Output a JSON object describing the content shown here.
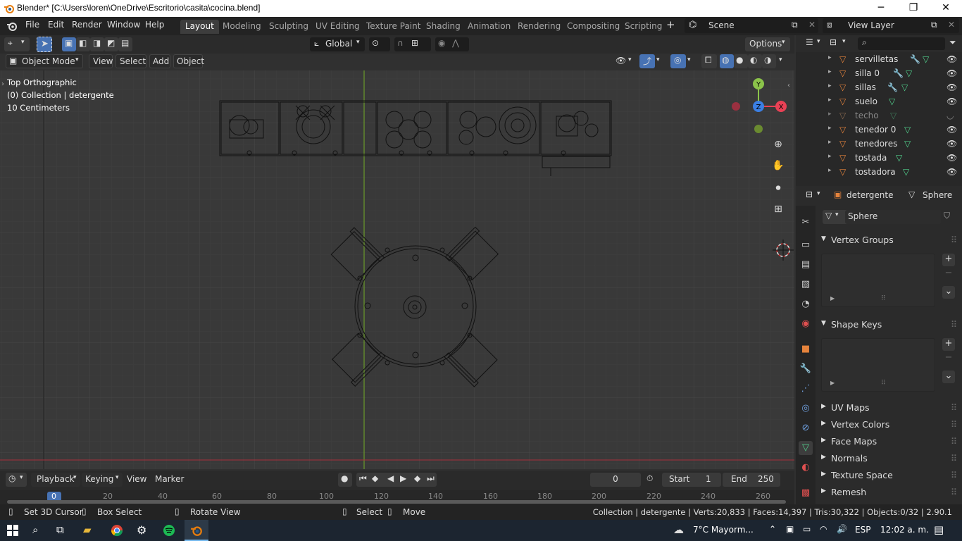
{
  "window": {
    "title": "Blender* [C:\\Users\\loren\\OneDrive\\Escritorio\\casita\\cocina.blend]",
    "minimize": "─",
    "maximize": "❐",
    "close": "✕"
  },
  "menu": {
    "items": [
      "File",
      "Edit",
      "Render",
      "Window",
      "Help"
    ]
  },
  "workspaces": {
    "tabs": [
      "Layout",
      "Modeling",
      "Sculpting",
      "UV Editing",
      "Texture Paint",
      "Shading",
      "Animation",
      "Rendering",
      "Compositing",
      "Scripting"
    ],
    "active": "Layout",
    "add": "+"
  },
  "scene": {
    "name": "Scene",
    "view_layer": "View Layer"
  },
  "toolbar": {
    "orientation": "Global",
    "options": "Options"
  },
  "viewport_header": {
    "mode": "Object Mode",
    "menus": [
      "View",
      "Select",
      "Add",
      "Object"
    ]
  },
  "viewport": {
    "view_name": "Top Orthographic",
    "collection_info": "(0) Collection | detergente",
    "scale": "10 Centimeters",
    "gizmo": {
      "y": "Y",
      "x": "X",
      "z": "Z"
    }
  },
  "outliner": {
    "items": [
      {
        "name": "servilletas",
        "modifier": true,
        "visible": true
      },
      {
        "name": "silla 0",
        "modifier": true,
        "visible": true
      },
      {
        "name": "sillas",
        "modifier": true,
        "visible": true
      },
      {
        "name": "suelo",
        "modifier": false,
        "visible": true
      },
      {
        "name": "techo",
        "modifier": false,
        "visible": false
      },
      {
        "name": "tenedor 0",
        "modifier": false,
        "visible": true
      },
      {
        "name": "tenedores",
        "modifier": false,
        "visible": true
      },
      {
        "name": "tostada",
        "modifier": false,
        "visible": true
      },
      {
        "name": "tostadora",
        "modifier": false,
        "visible": true
      }
    ]
  },
  "properties": {
    "object": "detergente",
    "mesh": "Sphere",
    "datablock": "Sphere",
    "panels_open": [
      "Vertex Groups",
      "Shape Keys"
    ],
    "panels_closed": [
      "UV Maps",
      "Vertex Colors",
      "Face Maps",
      "Normals",
      "Texture Space",
      "Remesh"
    ]
  },
  "timeline": {
    "menus": [
      "Playback",
      "Keying",
      "View",
      "Marker"
    ],
    "current_frame": "0",
    "start_label": "Start",
    "start": "1",
    "end_label": "End",
    "end": "250",
    "ruler": [
      "0",
      "20",
      "40",
      "60",
      "80",
      "100",
      "120",
      "140",
      "160",
      "180",
      "200",
      "220",
      "240",
      "260"
    ]
  },
  "status": {
    "hints": [
      "Set 3D Cursor",
      "Box Select",
      "Rotate View",
      "Select",
      "Move"
    ],
    "stats": "Collection | detergente | Verts:20,833 | Faces:14,397 | Tris:30,322 | Objects:0/32 | 2.90.1"
  },
  "taskbar": {
    "weather": "7°C  Mayorm...",
    "lang": "ESP",
    "time": "12:02 a. m."
  },
  "colors": {
    "accent": "#4772b3",
    "object_orange": "#e5833c",
    "mesh_green": "#52d18d",
    "axis_x": "#e94155",
    "axis_y": "#8bc34a",
    "axis_z": "#3b7fe3"
  }
}
